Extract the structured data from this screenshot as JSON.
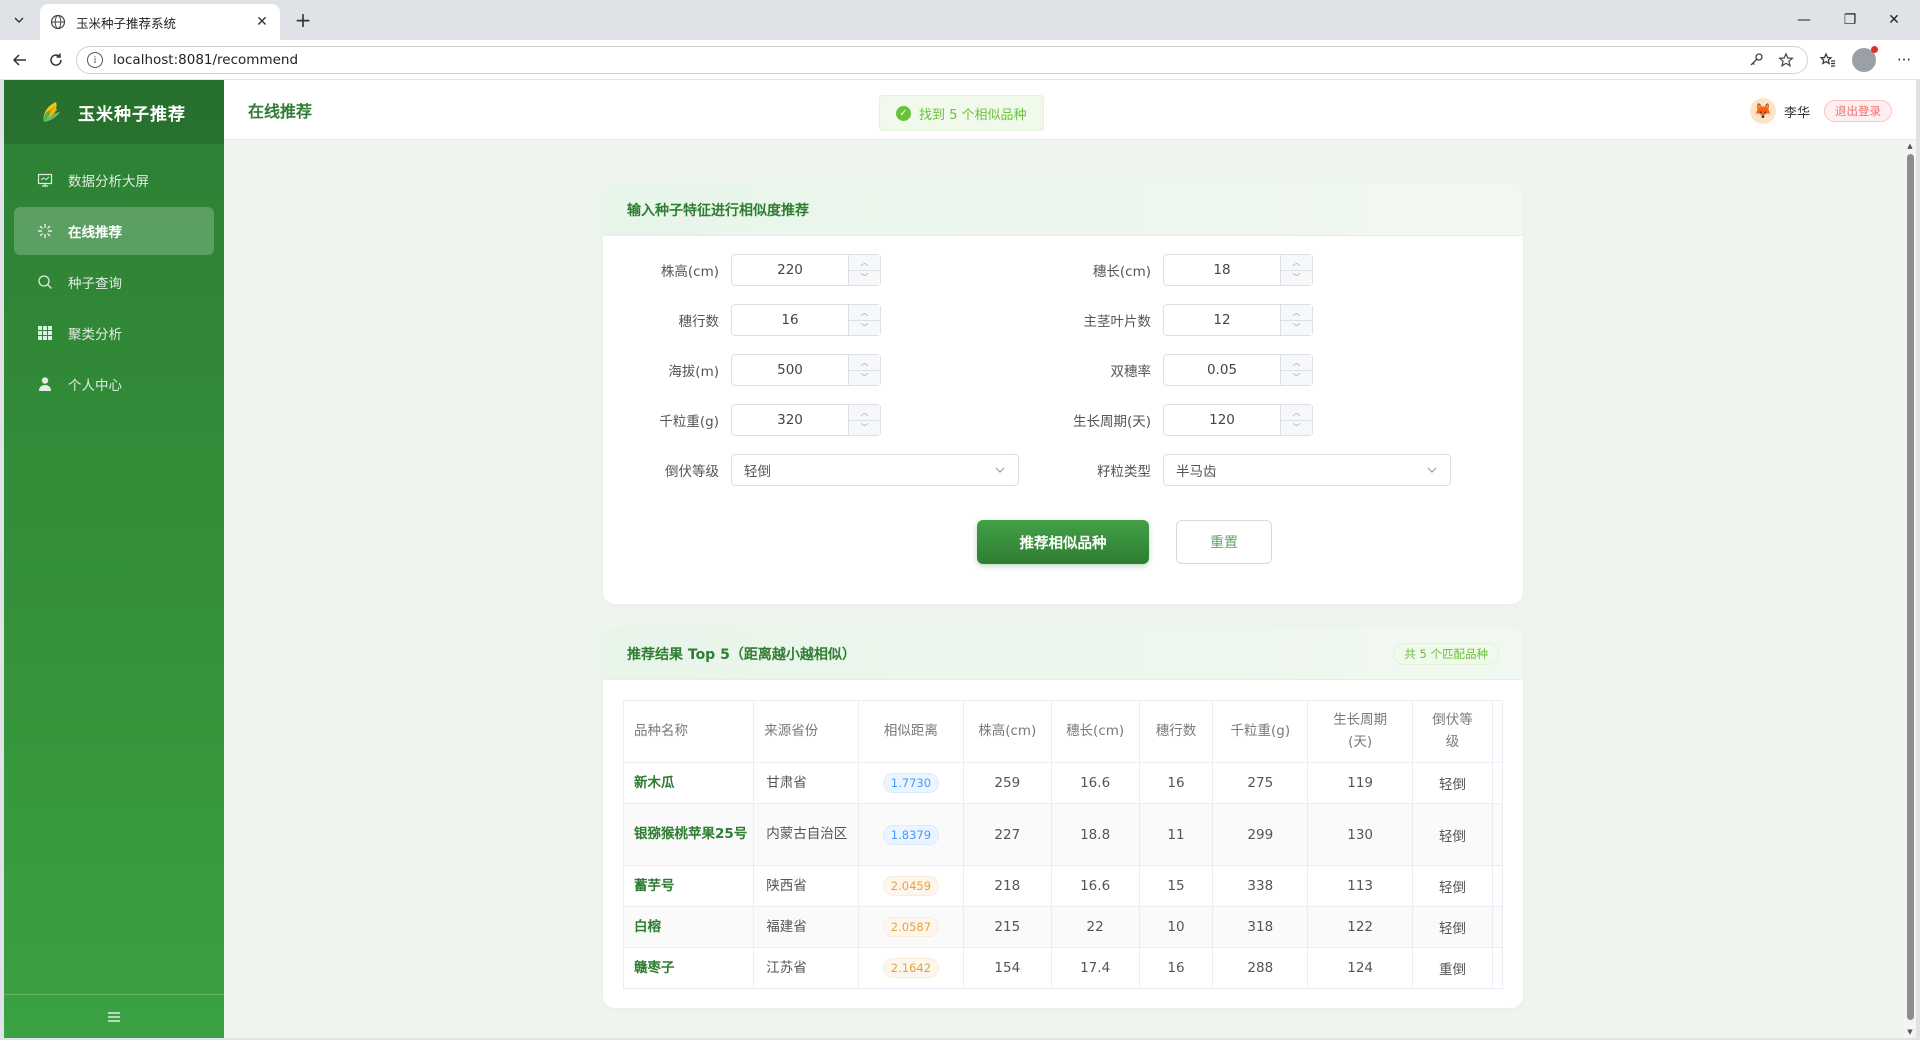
{
  "browser": {
    "tab_title": "玉米种子推荐系统",
    "url": "localhost:8081/recommend"
  },
  "sidebar": {
    "brand": "玉米种子推荐",
    "items": [
      {
        "label": "数据分析大屏",
        "icon": "monitor-icon"
      },
      {
        "label": "在线推荐",
        "icon": "sparkle-icon",
        "active": true
      },
      {
        "label": "种子查询",
        "icon": "search-icon"
      },
      {
        "label": "聚类分析",
        "icon": "grid-icon"
      },
      {
        "label": "个人中心",
        "icon": "user-icon"
      }
    ],
    "collapse_icon": "menu-icon"
  },
  "header": {
    "title": "在线推荐",
    "toast": "找到 5 个相似品种",
    "user_name": "李华",
    "logout": "退出登录"
  },
  "form": {
    "title": "输入种子特征进行相似度推荐",
    "fields": {
      "plant_height": {
        "label": "株高(cm)",
        "value": "220"
      },
      "ear_length": {
        "label": "穗长(cm)",
        "value": "18"
      },
      "ear_rows": {
        "label": "穗行数",
        "value": "16"
      },
      "leaf_count": {
        "label": "主茎叶片数",
        "value": "12"
      },
      "altitude": {
        "label": "海拔(m)",
        "value": "500"
      },
      "double_ear_rate": {
        "label": "双穗率",
        "value": "0.05"
      },
      "kernel_weight": {
        "label": "千粒重(g)",
        "value": "320"
      },
      "growth_period": {
        "label": "生长周期(天)",
        "value": "120"
      },
      "lodging": {
        "label": "倒伏等级",
        "value": "轻倒"
      },
      "kernel_type": {
        "label": "籽粒类型",
        "value": "半马齿"
      }
    },
    "submit": "推荐相似品种",
    "reset": "重置"
  },
  "results": {
    "title": "推荐结果 Top 5（距离越小越相似）",
    "count_badge": "共 5 个匹配品种",
    "columns": [
      "品种名称",
      "来源省份",
      "相似距离",
      "株高(cm)",
      "穗长(cm)",
      "穗行数",
      "千粒重(g)",
      "生长周期(天)",
      "倒伏等级"
    ],
    "rows": [
      {
        "name": "新木瓜",
        "province": "甘肃省",
        "distance": "1.7730",
        "dist_color": "blue",
        "height": "259",
        "ear_len": "16.6",
        "rows": "16",
        "weight": "275",
        "period": "119",
        "lodging": "轻倒"
      },
      {
        "name": "银猕猴桃苹果25号",
        "province": "内蒙古自治区",
        "distance": "1.8379",
        "dist_color": "blue",
        "height": "227",
        "ear_len": "18.8",
        "rows": "11",
        "weight": "299",
        "period": "130",
        "lodging": "轻倒"
      },
      {
        "name": "蓄芋号",
        "province": "陕西省",
        "distance": "2.0459",
        "dist_color": "orange",
        "height": "218",
        "ear_len": "16.6",
        "rows": "15",
        "weight": "338",
        "period": "113",
        "lodging": "轻倒"
      },
      {
        "name": "白榕",
        "province": "福建省",
        "distance": "2.0587",
        "dist_color": "orange",
        "height": "215",
        "ear_len": "22",
        "rows": "10",
        "weight": "318",
        "period": "122",
        "lodging": "轻倒"
      },
      {
        "name": "赣枣子",
        "province": "江苏省",
        "distance": "2.1642",
        "dist_color": "orange",
        "height": "154",
        "ear_len": "17.4",
        "rows": "16",
        "weight": "288",
        "period": "124",
        "lodging": "重倒"
      }
    ]
  },
  "colors": {
    "brand_green": "#2e7d32",
    "success": "#67c23a",
    "danger": "#f56c6c",
    "distance_blue": "#409eff",
    "distance_orange": "#e6a23c"
  }
}
